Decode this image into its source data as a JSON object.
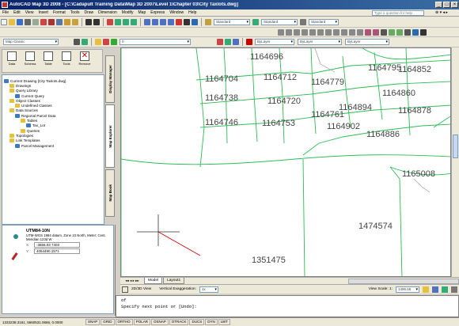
{
  "window": {
    "title": "AutoCAD Map 3D 2008 - [C:\\Cadapult Training Data\\Map 3D 2007\\Level 1\\Chapter 03\\City Taxlots.dwg]",
    "help_placeholder": "Type a question for help"
  },
  "menubar": [
    "File",
    "Edit",
    "View",
    "Insert",
    "Format",
    "Tools",
    "Draw",
    "Dimension",
    "Modify",
    "Map",
    "Express",
    "Window",
    "Help"
  ],
  "toolbars": {
    "workspace_combo": "Map Classic",
    "layer_combo": "Standard",
    "text_style_combo": "Standard",
    "color_combo": "ByLayer",
    "linetype_combo": "ByLayer",
    "lineweight_combo": "ByLayer",
    "layer_state": "0"
  },
  "task_pane": {
    "tools": [
      {
        "label": "Data",
        "icon": "data-icon"
      },
      {
        "label": "Schema",
        "icon": "schema-icon"
      },
      {
        "label": "Table",
        "icon": "table-icon"
      },
      {
        "label": "Tools",
        "icon": "tools-icon"
      },
      {
        "label": "Remove",
        "icon": "remove-icon"
      }
    ],
    "tree": [
      {
        "label": "Current Drawing [City Taxlots.dwg]",
        "level": 0,
        "color": "#3a78c8"
      },
      {
        "label": "Drawings",
        "level": 1,
        "color": "#e8c040"
      },
      {
        "label": "Query Library",
        "level": 1,
        "color": "#e8c040"
      },
      {
        "label": "Current Query",
        "level": 2,
        "color": "#3a78c8"
      },
      {
        "label": "Object Classes",
        "level": 1,
        "color": "#e8c040"
      },
      {
        "label": "Undefined Classes",
        "level": 2,
        "color": "#e8c040"
      },
      {
        "label": "Data Sources",
        "level": 1,
        "color": "#e8c040"
      },
      {
        "label": "Regional Parcel Data",
        "level": 2,
        "color": "#3a78c8"
      },
      {
        "label": "Tables",
        "level": 3,
        "color": "#e8c040"
      },
      {
        "label": "Tax_Lot",
        "level": 4,
        "color": "#3a78c8"
      },
      {
        "label": "Queries",
        "level": 3,
        "color": "#e8c040"
      },
      {
        "label": "Topologies",
        "level": 1,
        "color": "#e8c040"
      },
      {
        "label": "Link Templates",
        "level": 1,
        "color": "#e8c040"
      },
      {
        "label": "Parcel Management",
        "level": 2,
        "color": "#3a78c8"
      }
    ],
    "side_tabs": [
      "Display Manager",
      "Map Explorer",
      "Map Book"
    ],
    "coordinate_system": {
      "code": "UTM84-10N",
      "description": "UTM-WGS 1984 datum, Zone 10 North, Meter; Cent. Meridian 123d W",
      "x_label": "X:",
      "x_value": "-3856.03 7403",
      "y_label": "Y:",
      "y_value": "4054490.1571"
    }
  },
  "drawing": {
    "parcel_labels": [
      {
        "text": "1164696",
        "row": "top"
      },
      {
        "text": "1164704"
      },
      {
        "text": "1164712"
      },
      {
        "text": "1164779"
      },
      {
        "text": "1164795"
      },
      {
        "text": "1164852"
      },
      {
        "text": "1164738"
      },
      {
        "text": "1164720"
      },
      {
        "text": "1164860"
      },
      {
        "text": "1164894"
      },
      {
        "text": "1164878"
      },
      {
        "text": "1164761"
      },
      {
        "text": "1164746"
      },
      {
        "text": "1164753"
      },
      {
        "text": "1164902"
      },
      {
        "text": "1164886"
      },
      {
        "text": "1165008"
      },
      {
        "text": "1351475"
      },
      {
        "text": "1474574"
      }
    ]
  },
  "layout_tabs": [
    "Model",
    "Layout1"
  ],
  "status": {
    "view_2d3d": "2D/3D View",
    "vertical_exaggeration_label": "Vertical Exaggeration:",
    "vertical_exaggeration_value": "1x",
    "view_scale_label": "View Scale: 1:",
    "view_scale_value": "1496.66"
  },
  "command_line": {
    "history": "of",
    "prompt": "Specify next point or [Undo]:"
  },
  "statusbar": {
    "coords": "1333238.3161, 5660531.0666, 0.0000",
    "modes": [
      "SNAP",
      "GRID",
      "ORTHO",
      "POLAR",
      "OSNAP",
      "OTRACK",
      "DUCS",
      "DYN",
      "LWT"
    ]
  }
}
